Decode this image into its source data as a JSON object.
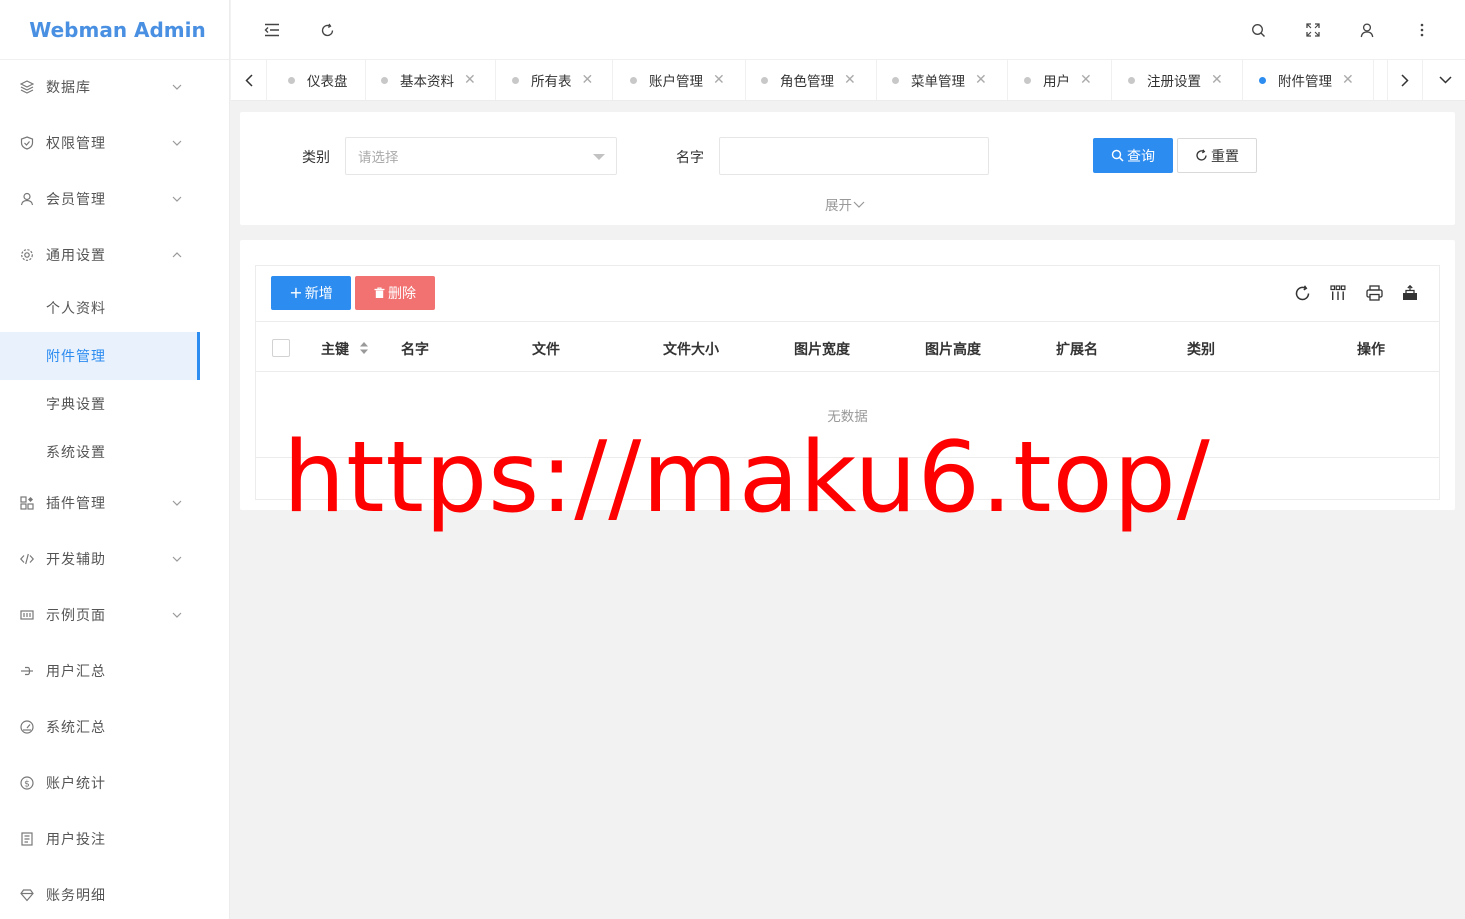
{
  "app": {
    "title": "Webman Admin"
  },
  "sidebar": {
    "items": [
      {
        "label": "数据库",
        "icon": "layers-icon",
        "expandable": true,
        "expanded": false
      },
      {
        "label": "权限管理",
        "icon": "shield-icon",
        "expandable": true,
        "expanded": false
      },
      {
        "label": "会员管理",
        "icon": "user-icon",
        "expandable": true,
        "expanded": false
      },
      {
        "label": "通用设置",
        "icon": "gear-icon",
        "expandable": true,
        "expanded": true,
        "children": [
          {
            "label": "个人资料",
            "active": false
          },
          {
            "label": "附件管理",
            "active": true
          },
          {
            "label": "字典设置",
            "active": false
          },
          {
            "label": "系统设置",
            "active": false
          }
        ]
      },
      {
        "label": "插件管理",
        "icon": "apps-icon",
        "expandable": true,
        "expanded": false
      },
      {
        "label": "开发辅助",
        "icon": "code-icon",
        "expandable": true,
        "expanded": false
      },
      {
        "label": "示例页面",
        "icon": "template-icon",
        "expandable": true,
        "expanded": false
      },
      {
        "label": "用户汇总",
        "icon": "chain-icon",
        "expandable": false
      },
      {
        "label": "系统汇总",
        "icon": "dashboard-icon",
        "expandable": false
      },
      {
        "label": "账户统计",
        "icon": "dollar-icon",
        "expandable": false
      },
      {
        "label": "用户投注",
        "icon": "receipt-icon",
        "expandable": false
      },
      {
        "label": "账务明细",
        "icon": "diamond-icon",
        "expandable": false
      }
    ]
  },
  "header": {
    "icons": [
      "collapse-menu-icon",
      "refresh-icon",
      "search-icon",
      "fullscreen-icon",
      "user-icon",
      "more-vertical-icon"
    ]
  },
  "tabs": [
    {
      "label": "仪表盘",
      "closable": false,
      "active": false
    },
    {
      "label": "基本资料",
      "closable": true,
      "active": false
    },
    {
      "label": "所有表",
      "closable": true,
      "active": false
    },
    {
      "label": "账户管理",
      "closable": true,
      "active": false
    },
    {
      "label": "角色管理",
      "closable": true,
      "active": false
    },
    {
      "label": "菜单管理",
      "closable": true,
      "active": false
    },
    {
      "label": "用户",
      "closable": true,
      "active": false
    },
    {
      "label": "注册设置",
      "closable": true,
      "active": false
    },
    {
      "label": "附件管理",
      "closable": true,
      "active": true
    }
  ],
  "search": {
    "category_label": "类别",
    "category_placeholder": "请选择",
    "name_label": "名字",
    "name_value": "",
    "query_label": "查询",
    "reset_label": "重置",
    "expand_label": "展开"
  },
  "table": {
    "add_label": "新增",
    "delete_label": "删除",
    "columns": [
      "主键",
      "名字",
      "文件",
      "文件大小",
      "图片宽度",
      "图片高度",
      "扩展名",
      "类别",
      "操作"
    ],
    "rows": [],
    "empty_text": "无数据",
    "toolbar_icons": [
      "refresh-icon",
      "columns-icon",
      "print-icon",
      "export-icon"
    ]
  },
  "watermark": {
    "text": "https://maku6.top/"
  },
  "colors": {
    "primary": "#2d8cf0",
    "danger": "#f27272",
    "logo": "#4a90e2",
    "watermark": "#ff0000"
  }
}
